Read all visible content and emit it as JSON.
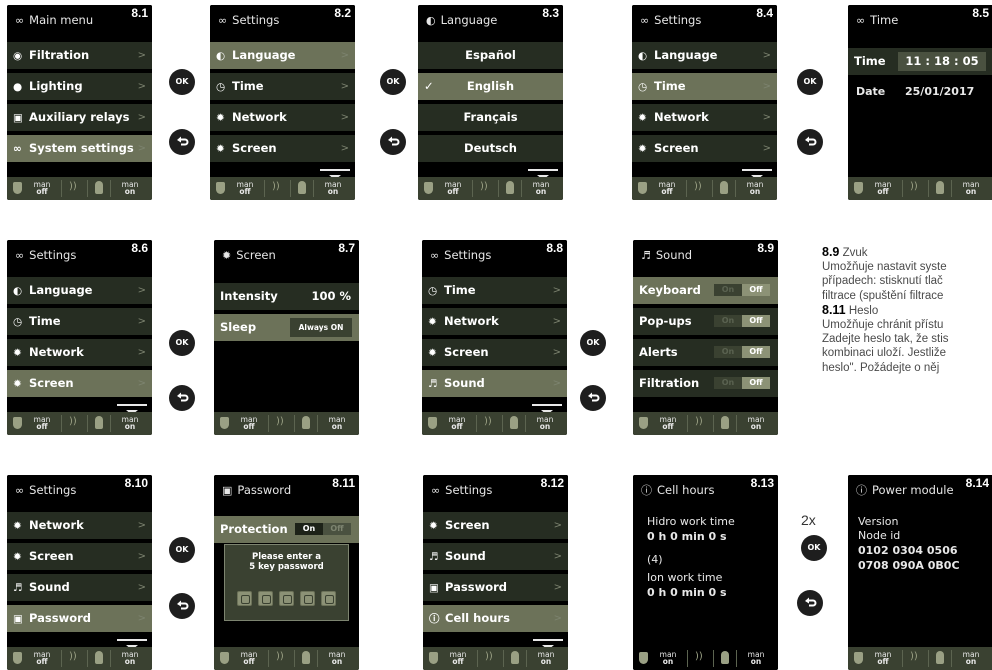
{
  "colors": {
    "screen_bg": "#000000",
    "row": "#262d22",
    "row_selected": "#6c7259",
    "footer": "#3a4131",
    "text": "#ffffff",
    "toggle_off": "#8c9276"
  },
  "footer": {
    "man": "man",
    "off": "off",
    "on": "on"
  },
  "nav": {
    "ok": "OK",
    "times": "2x"
  },
  "icons": {
    "back": "back-arrow-icon",
    "settings": "settings-icon",
    "water": "water-drop-icon",
    "bulb": "bulb-icon",
    "relay": "relay-icon",
    "globe": "language-icon",
    "clock": "clock-icon",
    "network": "network-icon",
    "sun": "brightness-icon",
    "speaker": "speaker-icon",
    "lock": "lock-icon",
    "info": "info-icon"
  },
  "screens": {
    "s81": {
      "id": "8.1",
      "title": "Main menu",
      "rows": [
        "Filtration",
        "Lighting",
        "Auxiliary relays",
        "System settings"
      ]
    },
    "s82": {
      "id": "8.2",
      "title": "Settings",
      "rows": [
        "Language",
        "Time",
        "Network",
        "Screen"
      ]
    },
    "s83": {
      "id": "8.3",
      "title": "Language",
      "rows": [
        "Español",
        "English",
        "Français",
        "Deutsch"
      ]
    },
    "s84": {
      "id": "8.4",
      "title": "Settings",
      "rows": [
        "Language",
        "Time",
        "Network",
        "Screen"
      ]
    },
    "s85": {
      "id": "8.5",
      "title": "Time",
      "time_label": "Time",
      "time_value": "11 : 18 : 05",
      "date_label": "Date",
      "date_value": "25/01/2017"
    },
    "s86": {
      "id": "8.6",
      "title": "Settings",
      "rows": [
        "Language",
        "Time",
        "Network",
        "Screen"
      ]
    },
    "s87": {
      "id": "8.7",
      "title": "Screen",
      "intensity_label": "Intensity",
      "intensity_value": "100 %",
      "sleep_label": "Sleep",
      "sleep_value": "Always ON"
    },
    "s88": {
      "id": "8.8",
      "title": "Settings",
      "rows": [
        "Time",
        "Network",
        "Screen",
        "Sound"
      ]
    },
    "s89": {
      "id": "8.9",
      "title": "Sound",
      "rows": [
        "Keyboard",
        "Pop-ups",
        "Alerts",
        "Filtration"
      ],
      "on": "On",
      "off": "Off"
    },
    "s810": {
      "id": "8.10",
      "title": "Settings",
      "rows": [
        "Network",
        "Screen",
        "Sound",
        "Password"
      ]
    },
    "s811": {
      "id": "8.11",
      "title": "Password",
      "protection": "Protection",
      "on": "On",
      "off": "Off",
      "prompt1": "Please enter a",
      "prompt2": "5 key password"
    },
    "s812": {
      "id": "8.12",
      "title": "Settings",
      "rows": [
        "Screen",
        "Sound",
        "Password",
        "Cell hours"
      ]
    },
    "s813": {
      "id": "8.13",
      "title": "Cell hours",
      "l1": "Hidro work time",
      "v1": "0 h 0 min 0 s",
      "n": "(4)",
      "l2": "Ion work time",
      "v2": "0 h 0 min 0 s",
      "foot_off": "on"
    },
    "s814": {
      "id": "8.14",
      "title": "Power module",
      "l1": "Version",
      "l2": "Node id",
      "v1": "0102 0304 0506",
      "v2": "0708 090A 0B0C"
    }
  },
  "doc": {
    "h1_num": "8.9",
    "h1": "Zvuk",
    "p1a": "Umožňuje nastavit syste",
    "p1b": "případech: stisknutí tlač",
    "p1c": "filtrace (spuštění filtrace",
    "h2_num": "8.11",
    "h2": "Heslo",
    "p2a": "Umožňuje chránit přístu",
    "p2b": "Zadejte heslo tak, že stis",
    "p2c": "kombinaci uloží. Jestliže",
    "p2d": "heslo\". Požádejte o něj"
  }
}
